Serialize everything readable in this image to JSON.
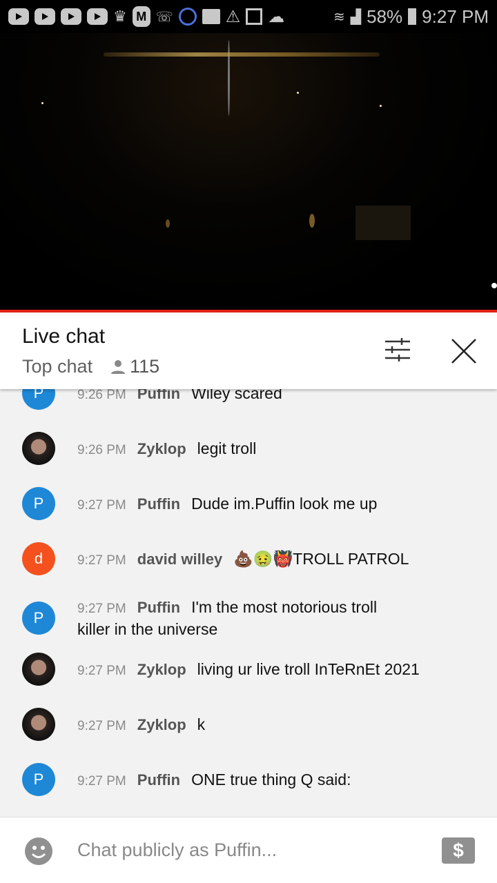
{
  "status_bar": {
    "icons": [
      "youtube-icon",
      "youtube-icon",
      "youtube-icon",
      "youtube-icon",
      "crown-icon",
      "m-app-icon",
      "missed-call-icon",
      "pokeball-icon",
      "folder-icon",
      "warning-icon",
      "image-icon",
      "cloud-icon",
      "wifi-icon",
      "signal-icon"
    ],
    "battery": "58%",
    "time": "9:27 PM"
  },
  "colors": {
    "progress": "#e62117",
    "puffin_avatar": "#1e88d6",
    "david_avatar": "#f4511e"
  },
  "header": {
    "title": "Live chat",
    "mode": "Top chat",
    "viewers": "115"
  },
  "messages": [
    {
      "time": "9:26 PM",
      "author": "Puffin",
      "avatar": "P",
      "text": "Wiley scared"
    },
    {
      "time": "9:26 PM",
      "author": "Zyklop",
      "avatar": "photo",
      "text": "legit troll"
    },
    {
      "time": "9:27 PM",
      "author": "Puffin",
      "avatar": "P",
      "text": "Dude im.Puffin look me up"
    },
    {
      "time": "9:27 PM",
      "author": "david willey",
      "avatar": "d",
      "text": "💩🤢👹TROLL PATROL"
    },
    {
      "time": "9:27 PM",
      "author": "Puffin",
      "avatar": "P",
      "text": "I'm the most notorious troll",
      "text2": "killer in the universe"
    },
    {
      "time": "9:27 PM",
      "author": "Zyklop",
      "avatar": "photo",
      "text": "living ur live troll InTeRnEt 2021"
    },
    {
      "time": "9:27 PM",
      "author": "Zyklop",
      "avatar": "photo",
      "text": "k"
    },
    {
      "time": "9:27 PM",
      "author": "Puffin",
      "avatar": "P",
      "text": "ONE true thing Q said:"
    }
  ],
  "input": {
    "placeholder": "Chat publicly as Puffin...",
    "money_icon": "$"
  }
}
